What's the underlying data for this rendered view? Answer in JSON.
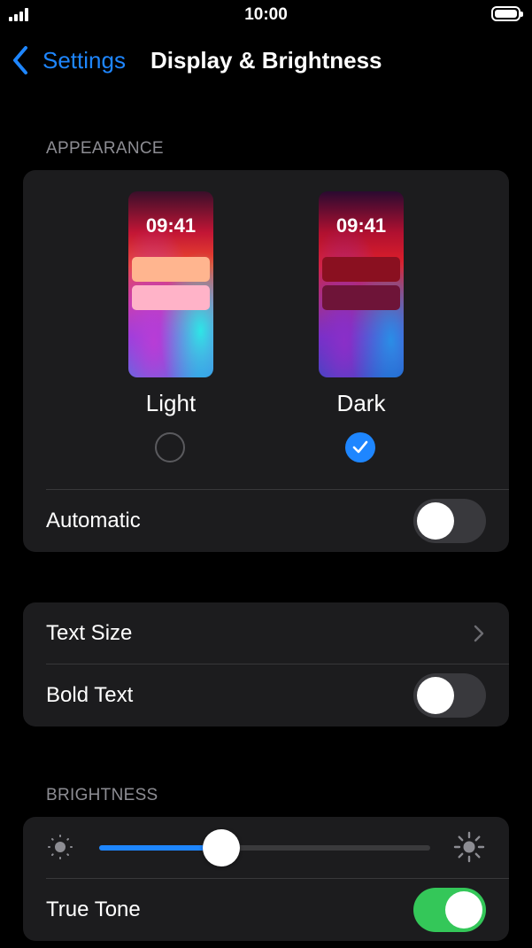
{
  "status_bar": {
    "time": "10:00",
    "signal_icon": "signal-bars-icon",
    "battery_icon": "battery-icon"
  },
  "nav": {
    "back_label": "Settings",
    "back_icon": "chevron-left-icon",
    "title": "Display & Brightness"
  },
  "appearance": {
    "header": "APPEARANCE",
    "light": {
      "label": "Light",
      "preview_time": "09:41",
      "selected": false
    },
    "dark": {
      "label": "Dark",
      "preview_time": "09:41",
      "selected": true
    },
    "automatic": {
      "label": "Automatic",
      "on": false
    }
  },
  "text_group": {
    "text_size": {
      "label": "Text Size",
      "icon": "chevron-right-icon"
    },
    "bold_text": {
      "label": "Bold Text",
      "on": false
    }
  },
  "brightness": {
    "header": "BRIGHTNESS",
    "level": 0.37,
    "min_icon": "sun-dim-icon",
    "max_icon": "sun-bright-icon",
    "true_tone": {
      "label": "True Tone",
      "on": true
    }
  },
  "colors": {
    "accent": "#1e86ff",
    "toggle_on": "#34c759",
    "group_bg": "#1c1c1e",
    "background": "#000000"
  }
}
